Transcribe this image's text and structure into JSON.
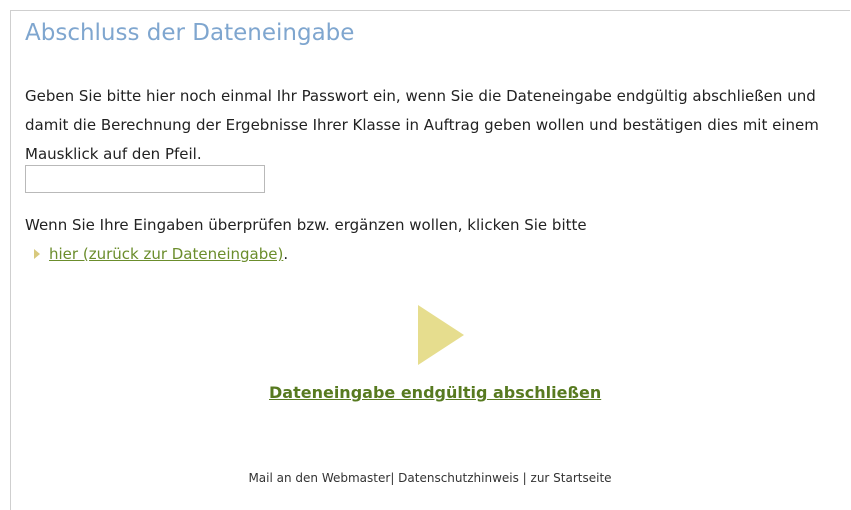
{
  "page": {
    "title": "Abschluss der Dateneingabe",
    "intro_text": "Geben Sie bitte hier noch einmal Ihr Passwort ein, wenn Sie die Dateneingabe endgültig abschließen und damit die Berechnung der Ergebnisse Ihrer Klasse in Auftrag geben wollen und bestätigen dies mit einem Mausklick auf den Pfeil.",
    "password_value": "",
    "review_text": "Wenn Sie Ihre Eingaben überprüfen bzw. ergänzen wollen, klicken Sie bitte",
    "back_link": "hier (zurück zur Dateneingabe)",
    "back_suffix": ".",
    "finish_link": "Dateneingabe endgültig abschließen"
  },
  "footer": {
    "mail": "Mail an den Webmaster",
    "sep1": "| ",
    "privacy": "Datenschutzhinweis",
    "sep2": " | ",
    "home": "zur Startseite"
  },
  "colors": {
    "title": "#7fa6cf",
    "arrow": "#e6dd8e",
    "link": "#577a20"
  }
}
